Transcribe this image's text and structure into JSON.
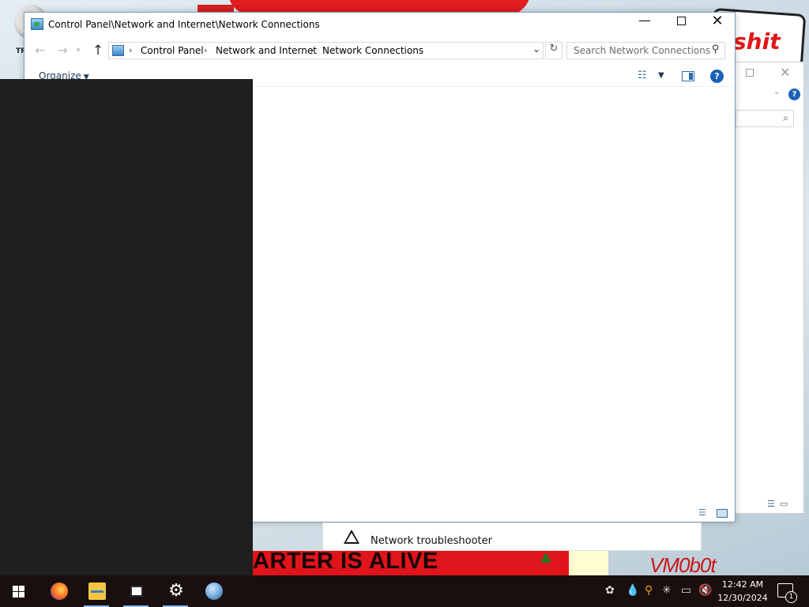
{
  "window": {
    "title": "Control Panel\\Network and Internet\\Network Connections",
    "minimize_glyph": "—",
    "close_glyph": "✕"
  },
  "address": {
    "segments": [
      "Control Panel",
      "Network and Internet",
      "Network Connections"
    ],
    "separator": "›",
    "search_placeholder": "Search Network Connections"
  },
  "toolbar": {
    "organize_label": "Organize",
    "help_glyph": "?"
  },
  "troubleshooter": {
    "label": "Network troubleshooter"
  },
  "wallpaper": {
    "banner_text": "ARTER IS ALIVE",
    "corner_text": "VM0b0t",
    "sign_text": "shit",
    "tiny_text": "TR"
  },
  "taskbar": {
    "apps": [
      "firefox-icon",
      "file-explorer-icon",
      "files-icon",
      "settings-icon",
      "globe-icon"
    ],
    "clock_time": "12:42 AM",
    "clock_date": "12/30/2024",
    "notification_count": "1"
  },
  "colors": {
    "taskbar": "#1a0f0f",
    "accent": "#1a62b8",
    "banner": "#e0141b",
    "occluder": "#1f1f1f"
  }
}
